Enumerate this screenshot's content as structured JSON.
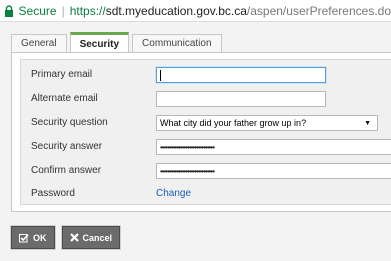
{
  "address_bar": {
    "secure_label": "Secure",
    "separator": "|",
    "url_scheme": "https://",
    "url_host": "sdt.myeducation.gov.bc.ca",
    "url_path": "/aspen/userPreferences.do"
  },
  "tabs": [
    {
      "label": "General"
    },
    {
      "label": "Security"
    },
    {
      "label": "Communication"
    }
  ],
  "form": {
    "primary_email": {
      "label": "Primary email",
      "value": ""
    },
    "alternate_email": {
      "label": "Alternate email",
      "value": ""
    },
    "security_question": {
      "label": "Security question",
      "value": "What city did your father grow up in?"
    },
    "security_answer": {
      "label": "Security answer",
      "value": "••••••••••••••••••••••••••••••"
    },
    "confirm_answer": {
      "label": "Confirm answer",
      "value": "••••••••••••••••••••••••••••••"
    },
    "password": {
      "label": "Password",
      "link": "Change"
    }
  },
  "buttons": {
    "ok_label": "OK",
    "cancel_label": "Cancel"
  },
  "colors": {
    "secure_green": "#0b8043",
    "active_tab_accent": "#6aa84f",
    "link_blue": "#1a5fb4",
    "button_gray": "#6b6b6b"
  },
  "icons": [
    "lock-icon",
    "dropdown-arrow-icon",
    "check-icon",
    "x-icon"
  ]
}
